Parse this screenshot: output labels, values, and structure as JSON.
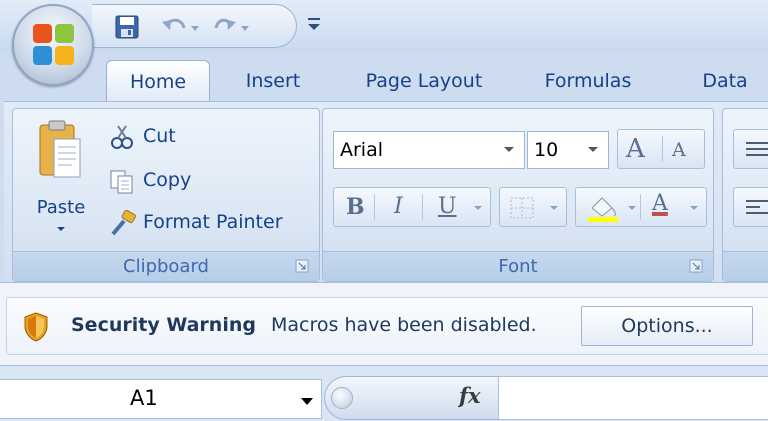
{
  "quick_access": {
    "save_icon": "save-icon",
    "undo_icon": "undo-icon",
    "redo_icon": "redo-icon",
    "customize_icon": "customize-toolbar-icon"
  },
  "tabs": [
    {
      "label": "Home",
      "active": true
    },
    {
      "label": "Insert"
    },
    {
      "label": "Page Layout"
    },
    {
      "label": "Formulas"
    },
    {
      "label": "Data"
    }
  ],
  "clipboard": {
    "paste_label": "Paste",
    "cut_label": "Cut",
    "copy_label": "Copy",
    "format_painter_label": "Format Painter",
    "group_label": "Clipboard"
  },
  "font": {
    "font_name": "Arial",
    "font_size": "10",
    "grow_glyph": "A",
    "shrink_glyph": "A",
    "bold_glyph": "B",
    "italic_glyph": "I",
    "underline_glyph": "U",
    "font_color_glyph": "A",
    "group_label": "Font",
    "fill_color": "#ffff00",
    "font_color": "#c0504d"
  },
  "security": {
    "title": "Security Warning",
    "message": "Macros have been disabled.",
    "options_label": "Options..."
  },
  "formula_bar": {
    "cell_ref": "A1",
    "fx_label": "fx",
    "formula_value": ""
  },
  "colors": {
    "ribbon_bg": "#d5e3f3",
    "tab_text": "#15428b",
    "group_label_text": "#3e6aaa",
    "warning_shield": "#e8a31a"
  }
}
